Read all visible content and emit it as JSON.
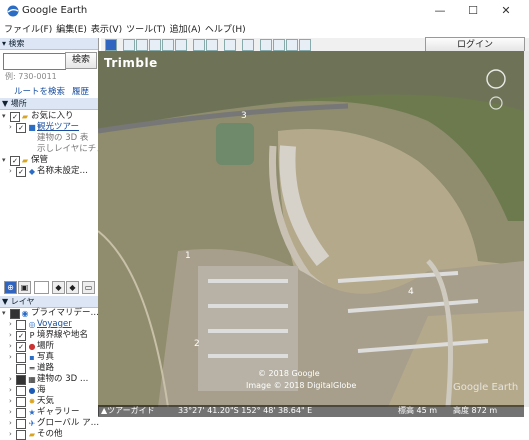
{
  "window": {
    "title": "Google Earth",
    "minimize": "—",
    "maximize": "☐",
    "close": "✕"
  },
  "menu": [
    "ファイル(F)",
    "編集(E)",
    "表示(V)",
    "ツール(T)",
    "追加(A)",
    "ヘルプ(H)"
  ],
  "login_label": "ログイン",
  "search": {
    "header": "▾ 検索",
    "placeholder": "",
    "button": "検索",
    "hint": "例: 730-0011",
    "route_link": "ルートを検索",
    "history_link": "履歴"
  },
  "places": {
    "header": "▼ 場所",
    "items": [
      {
        "label": "お気に入り",
        "icon": "folder-icon"
      },
      {
        "label": "観光ツアー",
        "icon": "tour-icon"
      },
      {
        "label": "建物の 3D 表",
        "icon": ""
      },
      {
        "label": "示しレイヤにチェッ",
        "icon": ""
      },
      {
        "label": "保管",
        "icon": "folder-icon"
      },
      {
        "label": "名称未設定…",
        "icon": "placemark-icon"
      }
    ]
  },
  "layers": {
    "header": "▼ レイヤ",
    "items": [
      {
        "label": "プライマリデー…",
        "icon": "globe-icon"
      },
      {
        "label": "Voyager",
        "icon": "voyager-icon"
      },
      {
        "label": "境界線や地名",
        "icon": "borders-icon"
      },
      {
        "label": "場所",
        "icon": "places-icon"
      },
      {
        "label": "写真",
        "icon": "photo-icon"
      },
      {
        "label": "道路",
        "icon": "road-icon"
      },
      {
        "label": "建物の 3D …",
        "icon": "building-icon"
      },
      {
        "label": "海",
        "icon": "ocean-icon"
      },
      {
        "label": "天気",
        "icon": "weather-icon"
      },
      {
        "label": "ギャラリー",
        "icon": "gallery-icon"
      },
      {
        "label": "グローバル ア…",
        "icon": "awareness-icon"
      },
      {
        "label": "その他",
        "icon": "more-icon"
      }
    ]
  },
  "map": {
    "provider_logo": "Trimble",
    "watermark": "Google Earth",
    "copyright1": "© 2018 Google",
    "copyright2": "Image © 2018 DigitalGlobe",
    "label_3": "3",
    "label_1": "1",
    "label_2": "2",
    "label_4": "4"
  },
  "status": {
    "tour_guide": "▲ツアーガイド",
    "coords": "33°27' 41.20\"S 152° 48' 38.64\" E",
    "elevation": "標高  45 m",
    "eye_alt": "高度  872 m"
  },
  "colors": {
    "accent": "#1a4fa0",
    "header_bg": "#dde6f4",
    "map_ground": "#8c8a6c"
  }
}
